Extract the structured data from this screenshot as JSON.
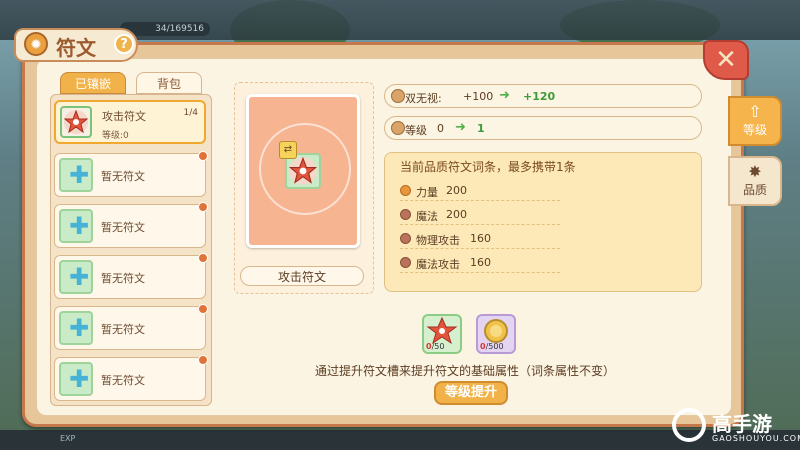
{
  "hud": {
    "xp_text": "34/169516",
    "exp_label": "EXP"
  },
  "window": {
    "title": "符文",
    "help": "?",
    "close": "✕"
  },
  "list_tabs": [
    {
      "label": "已镶嵌"
    },
    {
      "label": "背包"
    }
  ],
  "slots": [
    {
      "name": "攻击符文",
      "count": "1/4",
      "level": "等级:0"
    },
    {
      "name": "暂无符文"
    },
    {
      "name": "暂无符文"
    },
    {
      "name": "暂无符文"
    },
    {
      "name": "暂无符文"
    },
    {
      "name": "暂无符文"
    }
  ],
  "card": {
    "name": "攻击符文"
  },
  "stats": {
    "ignore": {
      "label": "双无视:",
      "current": "+100",
      "next": "+120"
    },
    "level": {
      "label": "等级",
      "current": "0",
      "next": "1"
    }
  },
  "attrs": {
    "title": "当前品质符文词条，最多携带1条",
    "rows": [
      {
        "name": "力量",
        "value": "200"
      },
      {
        "name": "魔法",
        "value": "200"
      },
      {
        "name": "物理攻击",
        "value": "160"
      },
      {
        "name": "魔法攻击",
        "value": "160"
      }
    ]
  },
  "materials": [
    {
      "have": "0",
      "need": "/50"
    },
    {
      "have": "0",
      "need": "/500"
    }
  ],
  "description": "通过提升符文槽来提升符文的基础属性（词条属性不变）",
  "upgrade_button": "等级提升",
  "side_tabs": [
    {
      "label": "等级"
    },
    {
      "label": "品质"
    }
  ],
  "watermark": {
    "name": "高手游",
    "url": "GAOSHOUYOU.COM"
  }
}
